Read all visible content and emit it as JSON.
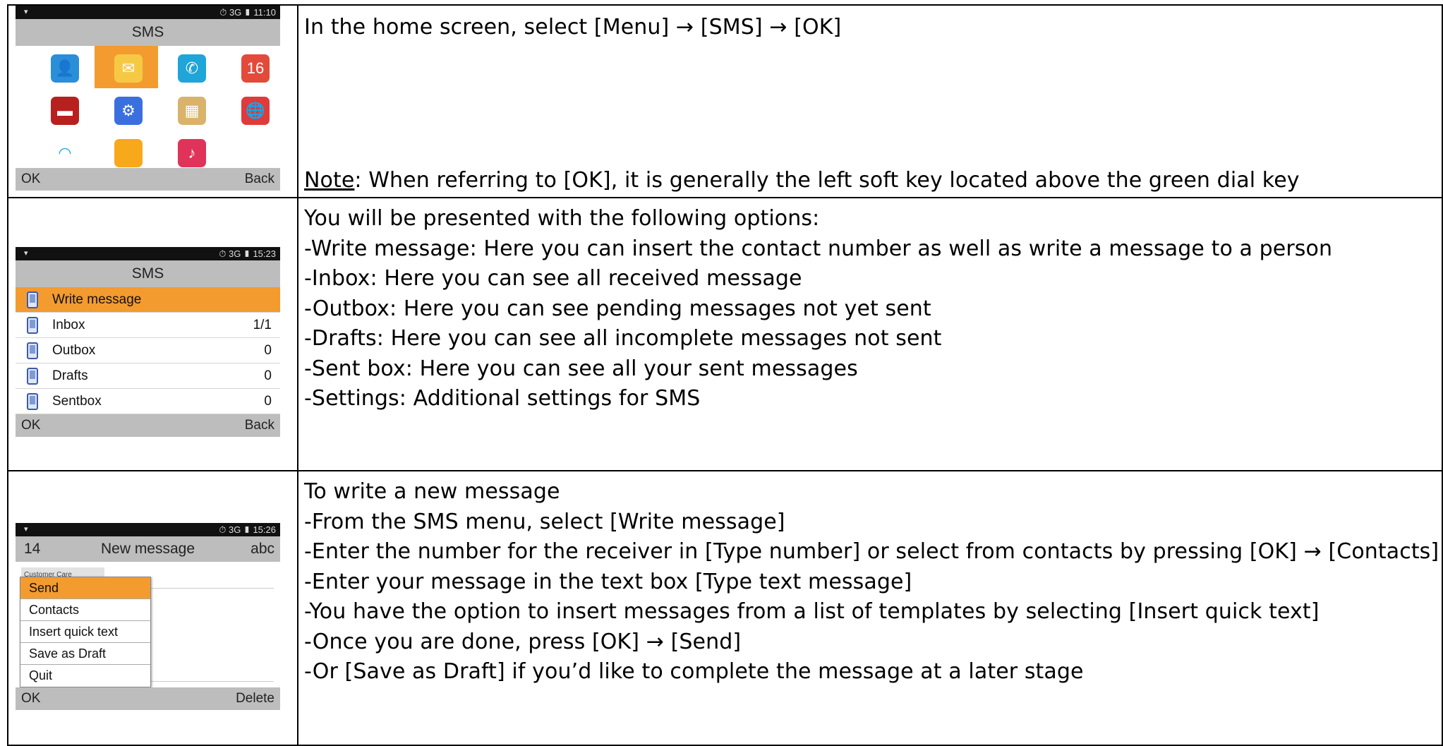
{
  "rows": [
    {
      "phone": {
        "status_time": "11:10",
        "status_net": "3G",
        "title": "SMS",
        "apps": [
          {
            "icon": "contacts-icon",
            "color": "#2a8fd8",
            "glyph": "👤",
            "selected": false
          },
          {
            "icon": "messages-icon",
            "color": "#f6c945",
            "glyph": "✉",
            "selected": true
          },
          {
            "icon": "phone-icon",
            "color": "#1fa5d8",
            "glyph": "✆",
            "selected": false
          },
          {
            "icon": "calendar-icon",
            "color": "#e44a3a",
            "glyph": "16",
            "selected": false
          },
          {
            "icon": "toolbox-icon",
            "color": "#b8201f",
            "glyph": "▬",
            "selected": false
          },
          {
            "icon": "settings-icon",
            "color": "#3b6fe0",
            "glyph": "⚙",
            "selected": false
          },
          {
            "icon": "radio-icon",
            "color": "#d9b36a",
            "glyph": "▦",
            "selected": false
          },
          {
            "icon": "browser-icon",
            "color": "#e03b3b",
            "glyph": "🌐",
            "selected": false
          },
          {
            "icon": "wifi-icon",
            "color": "#ffffff",
            "glyph": "◠",
            "selected": false
          },
          {
            "icon": "folder-icon",
            "color": "#f7a81b",
            "glyph": " ",
            "selected": false
          },
          {
            "icon": "music-icon",
            "color": "#e0335a",
            "glyph": "♪",
            "selected": false
          }
        ],
        "left_key": "OK",
        "right_key": "Back"
      },
      "lines": [
        "In the home screen, select [Menu] → [SMS] → [OK]"
      ],
      "note_label": "Note",
      "note_text": ": When referring to [OK], it is generally the left soft key located above the green dial key"
    },
    {
      "phone": {
        "status_time": "15:23",
        "status_net": "3G",
        "title": "SMS",
        "items": [
          {
            "label": "Write message",
            "count": "",
            "selected": true
          },
          {
            "label": "Inbox",
            "count": "1/1",
            "selected": false
          },
          {
            "label": "Outbox",
            "count": "0",
            "selected": false
          },
          {
            "label": "Drafts",
            "count": "0",
            "selected": false
          },
          {
            "label": "Sentbox",
            "count": "0",
            "selected": false
          }
        ],
        "left_key": "OK",
        "right_key": "Back"
      },
      "lines": [
        "You will be presented with the following options:",
        "-Write message: Here you can insert the contact number as well as write a message to a person",
        "-Inbox: Here you can see all received message",
        "-Outbox: Here you can see pending messages not yet sent",
        "-Drafts: Here you can see all incomplete messages not sent",
        "-Sent box: Here you can see all your sent messages",
        "-Settings: Additional settings for SMS"
      ]
    },
    {
      "phone": {
        "status_time": "15:26",
        "status_net": "3G",
        "count": "14",
        "title": "New message",
        "mode": "abc",
        "recipient_hint": "Customer Care",
        "menu": [
          {
            "label": "Send",
            "selected": true
          },
          {
            "label": "Contacts",
            "selected": false
          },
          {
            "label": "Insert quick text",
            "selected": false
          },
          {
            "label": "Save as Draft",
            "selected": false
          },
          {
            "label": "Quit",
            "selected": false
          }
        ],
        "left_key": "OK",
        "right_key": "Delete"
      },
      "lines": [
        "To write a new message",
        "-From the SMS menu, select [Write message]",
        "-Enter the number for the receiver in [Type number] or select from contacts by pressing [OK] → [Contacts]",
        "-Enter your message in the text box [Type text message]",
        "-You have the option to insert messages from a list of templates by selecting [Insert quick text]",
        "-Once you are done, press [OK] → [Send]",
        "-Or [Save as Draft] if you’d like to complete the message at a later stage"
      ]
    }
  ]
}
